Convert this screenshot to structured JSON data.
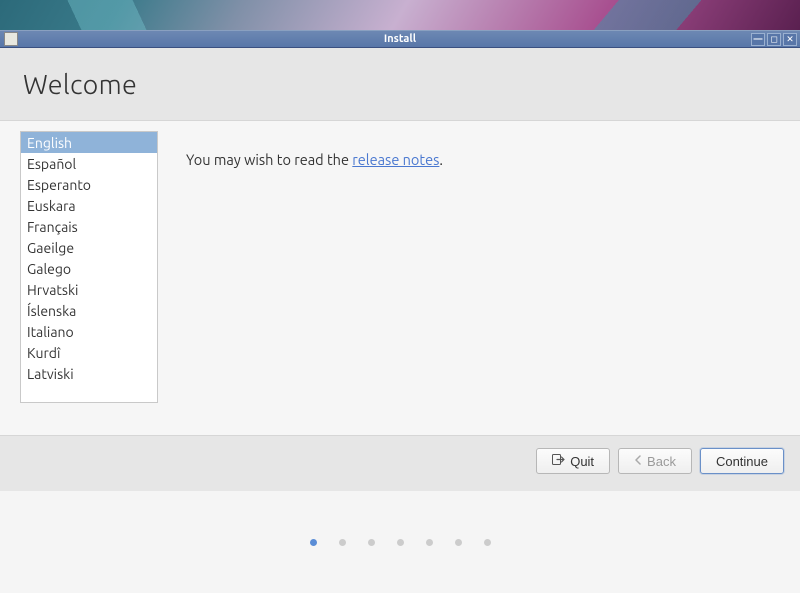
{
  "titlebar": {
    "title": "Install"
  },
  "page": {
    "heading": "Welcome"
  },
  "languages": {
    "items": [
      "English",
      "Español",
      "Esperanto",
      "Euskara",
      "Français",
      "Gaeilge",
      "Galego",
      "Hrvatski",
      "Íslenska",
      "Italiano",
      "Kurdî",
      "Latviski"
    ],
    "selected_index": 0
  },
  "info": {
    "prefix": "You may wish to read the ",
    "link_text": "release notes",
    "suffix": "."
  },
  "buttons": {
    "quit": "Quit",
    "back": "Back",
    "continue": "Continue"
  },
  "pager": {
    "count": 7,
    "active": 0
  }
}
